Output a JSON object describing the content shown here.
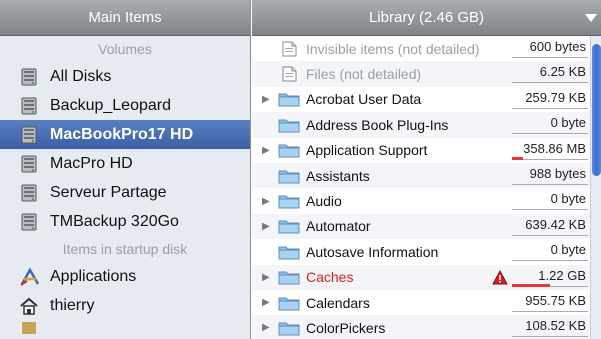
{
  "sidebar": {
    "header": "Main Items",
    "section_volumes": "Volumes",
    "volumes": [
      {
        "label": "All Disks",
        "icon": "disk-icon"
      },
      {
        "label": "Backup_Leopard",
        "icon": "disk-icon"
      },
      {
        "label": "MacBookPro17 HD",
        "icon": "disk-icon",
        "selected": true
      },
      {
        "label": "MacPro HD",
        "icon": "disk-icon"
      },
      {
        "label": "Serveur Partage",
        "icon": "disk-icon"
      },
      {
        "label": "TMBackup 320Go",
        "icon": "disk-icon"
      }
    ],
    "section_startup": "Items in startup disk",
    "startup_items": [
      {
        "label": "Applications",
        "icon": "applications-icon"
      },
      {
        "label": "thierry",
        "icon": "home-icon"
      }
    ]
  },
  "main": {
    "header": "Library (2.46 GB)",
    "rows": [
      {
        "label": "Invisible items (not detailed)",
        "size": "600 bytes",
        "icon": "document-icon",
        "dim": true,
        "disclosure": false,
        "fraction": 0
      },
      {
        "label": "Files (not detailed)",
        "size": "6.25 KB",
        "icon": "document-icon",
        "dim": true,
        "disclosure": false,
        "fraction": 0
      },
      {
        "label": "Acrobat User Data",
        "size": "259.79 KB",
        "icon": "folder-icon",
        "disclosure": true,
        "fraction": 0
      },
      {
        "label": "Address Book Plug-Ins",
        "size": "0 byte",
        "icon": "folder-icon",
        "disclosure": false,
        "fraction": 0
      },
      {
        "label": "Application Support",
        "size": "358.86 MB",
        "icon": "folder-icon",
        "disclosure": true,
        "fraction": 0.14
      },
      {
        "label": "Assistants",
        "size": "988 bytes",
        "icon": "folder-icon",
        "disclosure": false,
        "fraction": 0
      },
      {
        "label": "Audio",
        "size": "0 byte",
        "icon": "folder-icon",
        "disclosure": true,
        "fraction": 0
      },
      {
        "label": "Automator",
        "size": "639.42 KB",
        "icon": "folder-icon",
        "disclosure": true,
        "fraction": 0
      },
      {
        "label": "Autosave Information",
        "size": "0 byte",
        "icon": "folder-icon",
        "disclosure": false,
        "fraction": 0
      },
      {
        "label": "Caches",
        "size": "1.22 GB",
        "icon": "folder-icon",
        "disclosure": true,
        "red": true,
        "warning": true,
        "fraction": 0.5
      },
      {
        "label": "Calendars",
        "size": "955.75 KB",
        "icon": "folder-icon",
        "disclosure": true,
        "fraction": 0
      },
      {
        "label": "ColorPickers",
        "size": "108.52 KB",
        "icon": "folder-icon",
        "disclosure": true,
        "fraction": 0
      }
    ]
  },
  "colors": {
    "selection": "#3a5fa6",
    "warning_text": "#d42020",
    "usage_bar": "#ee3333",
    "folder": "#8fc0e8"
  }
}
